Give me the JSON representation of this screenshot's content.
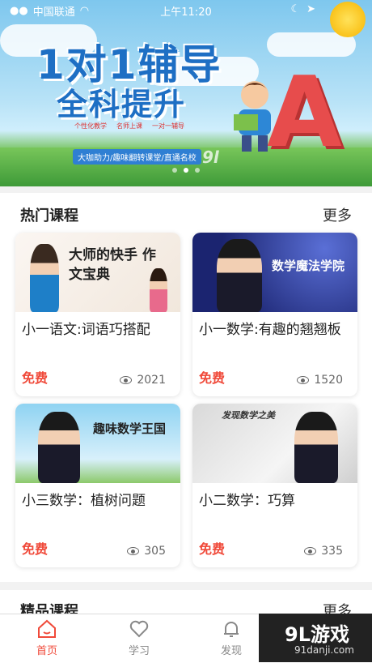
{
  "status": {
    "carrier": "中国联通",
    "time": "上午11:20"
  },
  "banner": {
    "title_line1": "1对1辅导",
    "title_line2": "全科提升",
    "tags": [
      "个性化教学",
      "名师上课",
      "一对一辅导"
    ],
    "slogan": "大咖助力/趣味翻转课堂/直通名校",
    "watermark": "9l"
  },
  "hot": {
    "title": "热门课程",
    "more": "更多",
    "courses": [
      {
        "thumb_text": "大师的快手 作文宝典",
        "title": "小一语文:词语巧搭配",
        "price": "免费",
        "views": "2021"
      },
      {
        "thumb_text": "数学魔法学院",
        "title": "小一数学:有趣的翘翘板",
        "price": "免费",
        "views": "1520"
      },
      {
        "thumb_text": "趣味数学王国",
        "title": "小三数学：植树问题",
        "price": "免费",
        "views": "305"
      },
      {
        "thumb_text": "发现数学之美",
        "title": "小二数学：巧算",
        "price": "免费",
        "views": "335"
      }
    ]
  },
  "premium": {
    "title": "精品课程",
    "more": "更多"
  },
  "tabs": [
    {
      "label": "首页",
      "icon": "home-icon"
    },
    {
      "label": "学习",
      "icon": "heart-icon"
    },
    {
      "label": "发现",
      "icon": "bell-icon"
    }
  ],
  "corner_logo": {
    "big": "9L游戏",
    "small": "91danji.com"
  },
  "colors": {
    "accent": "#f04a3a",
    "banner_blue": "#1e6fc4"
  }
}
